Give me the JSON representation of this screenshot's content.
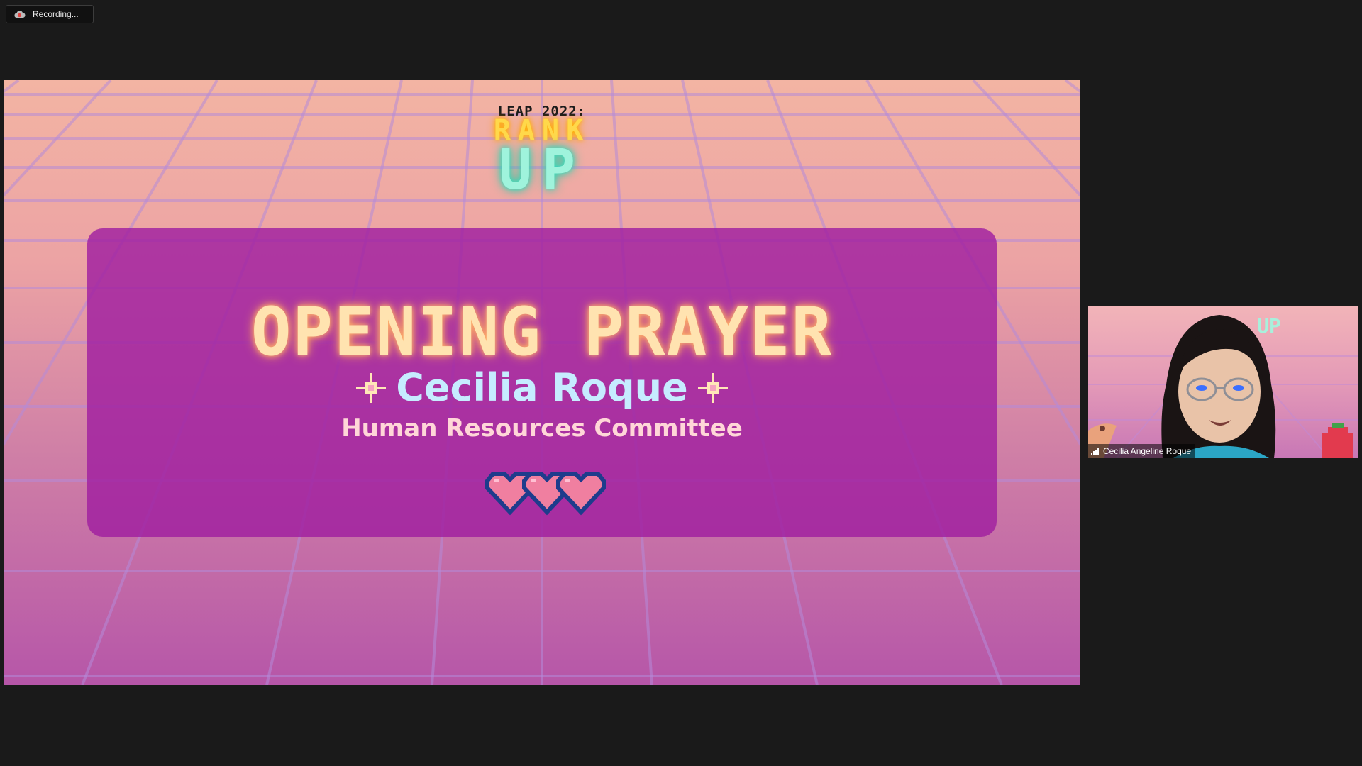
{
  "recording": {
    "label": "Recording...",
    "icon": "recording-cloud-icon"
  },
  "slide": {
    "event_line": "LEAP 2022:",
    "rank": "RANK",
    "up": "UP",
    "title": "OPENING PRAYER",
    "presenter": "Cecilia Roque",
    "committee": "Human Resources Committee",
    "hearts_icon": "pixel-hearts-icon",
    "sparkle_icon": "sparkle-icon"
  },
  "participant": {
    "name": "Cecilia Angeline Roque",
    "signal_icon": "signal-bars-icon"
  },
  "colors": {
    "app_background": "#1a1a1a",
    "card": "#a01ea0",
    "title_glow": "#ffe3b0",
    "presenter_name": "#c6ecff"
  }
}
